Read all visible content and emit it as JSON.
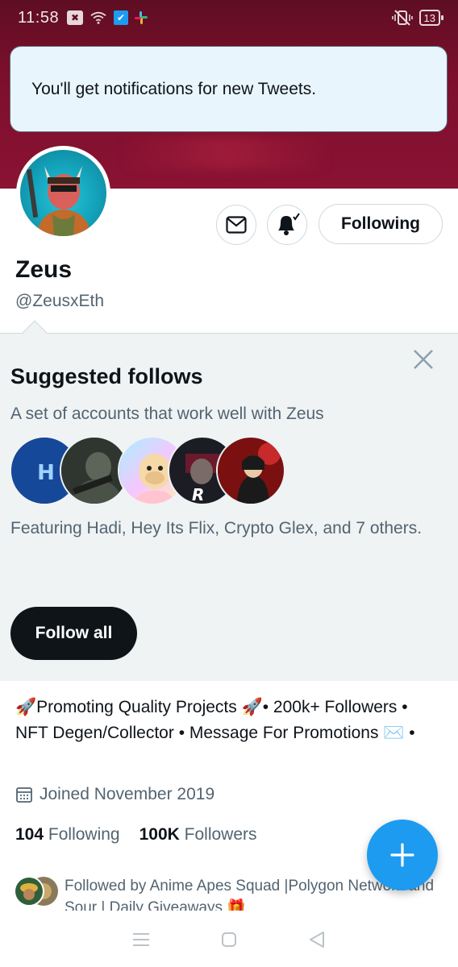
{
  "status_bar": {
    "time": "11:58",
    "battery": "13"
  },
  "toast": {
    "message": "You'll get notifications for new Tweets."
  },
  "profile": {
    "name": "Zeus",
    "handle": "@ZeusxEth",
    "following_button": "Following",
    "bio": "🚀Promoting Quality Projects 🚀• 200k+ Followers • NFT Degen/Collector • Message For Promotions ✉️ •",
    "joined": "Joined November 2019",
    "following_count": "104",
    "following_label": "Following",
    "followers_count": "100K",
    "followers_label": "Followers",
    "followed_by": "Followed by Anime Apes Squad |Polygon Network and Sour | Daily Giveaways 🎁"
  },
  "suggested": {
    "title": "Suggested follows",
    "subtitle": "A set of accounts that work well with Zeus",
    "featuring": "Featuring Hadi, Hey Its Flix, Crypto Glex, and 7 others.",
    "follow_all": "Follow all"
  },
  "colors": {
    "accent": "#1d9bf0",
    "banner": "#7c0f2c",
    "text": "#0f1419",
    "muted": "#536471"
  },
  "icons": [
    "message-icon",
    "notification-bell-icon",
    "close-icon",
    "calendar-icon",
    "compose-plus-icon",
    "menu-nav-icon",
    "home-nav-icon",
    "back-nav-icon"
  ]
}
